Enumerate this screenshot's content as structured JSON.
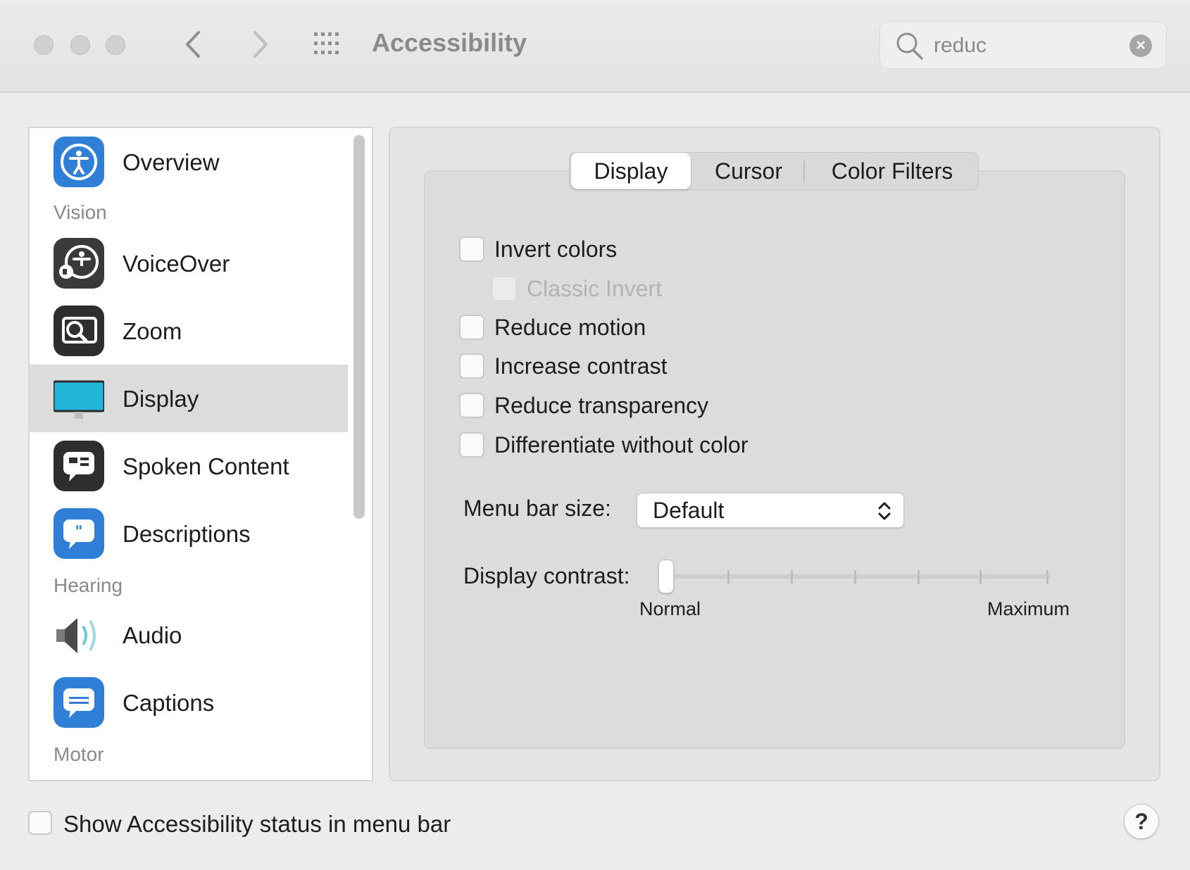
{
  "window": {
    "title": "Accessibility"
  },
  "search": {
    "value": "reduc"
  },
  "sidebar": {
    "items": [
      {
        "label": "Overview",
        "icon": "accessibility-icon"
      },
      {
        "label": "VoiceOver",
        "icon": "voiceover-icon"
      },
      {
        "label": "Zoom",
        "icon": "zoom-icon"
      },
      {
        "label": "Display",
        "icon": "display-icon"
      },
      {
        "label": "Spoken Content",
        "icon": "spoken-content-icon"
      },
      {
        "label": "Descriptions",
        "icon": "descriptions-icon"
      },
      {
        "label": "Audio",
        "icon": "speaker-icon"
      },
      {
        "label": "Captions",
        "icon": "captions-icon"
      }
    ],
    "sections": {
      "vision": "Vision",
      "hearing": "Hearing",
      "motor": "Motor"
    },
    "selected": "Display"
  },
  "tabs": [
    {
      "label": "Display",
      "active": true
    },
    {
      "label": "Cursor",
      "active": false
    },
    {
      "label": "Color Filters",
      "active": false
    }
  ],
  "options": {
    "invert_colors": {
      "label": "Invert colors",
      "checked": false
    },
    "classic_invert": {
      "label": "Classic Invert",
      "checked": false,
      "enabled": false
    },
    "reduce_motion": {
      "label": "Reduce motion",
      "checked": false
    },
    "increase_contrast": {
      "label": "Increase contrast",
      "checked": false
    },
    "reduce_transparency": {
      "label": "Reduce transparency",
      "checked": false
    },
    "differentiate_without_color": {
      "label": "Differentiate without color",
      "checked": false
    }
  },
  "menu_bar_size": {
    "label": "Menu bar size:",
    "value": "Default"
  },
  "display_contrast": {
    "label": "Display contrast:",
    "min_label": "Normal",
    "max_label": "Maximum",
    "value": 0
  },
  "footer": {
    "status_checkbox_label": "Show Accessibility status in menu bar",
    "status_checked": false,
    "help_label": "?"
  },
  "colors": {
    "accent_blue": "#2f7fd6",
    "display_cyan": "#21b6d9",
    "selected_row": "#dcdcdc"
  }
}
